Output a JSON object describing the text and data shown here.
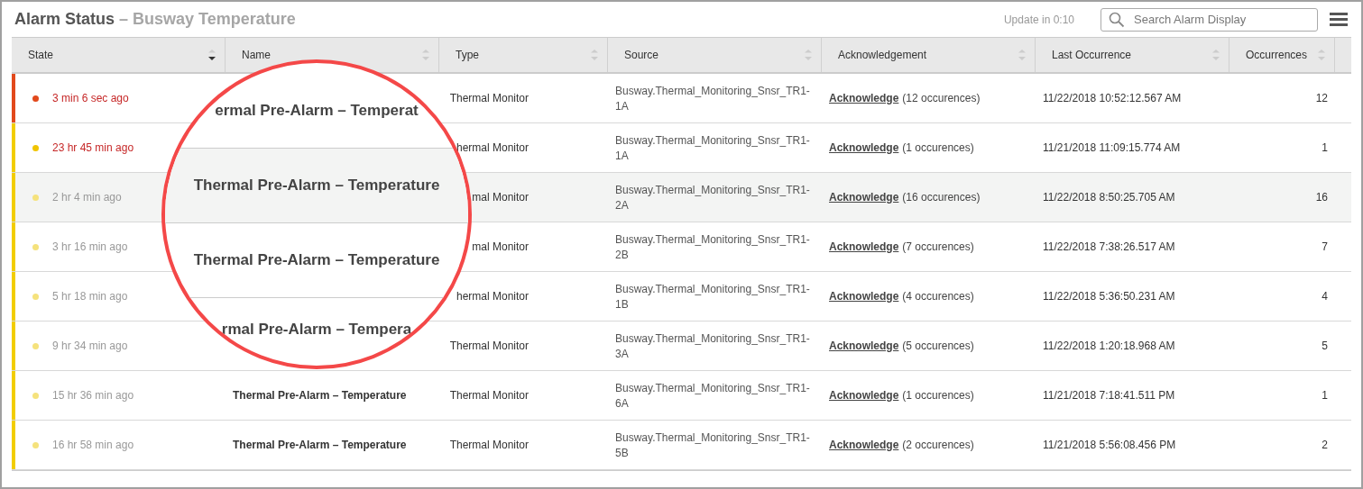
{
  "header": {
    "title": "Alarm Status",
    "subtitle": "– Busway Temperature",
    "update": "Update in 0:10",
    "search": {
      "placeholder": "Search Alarm Display"
    }
  },
  "table": {
    "columns": [
      {
        "label": "State",
        "sorted": true
      },
      {
        "label": "Name",
        "sorted": false
      },
      {
        "label": "Type",
        "sorted": false
      },
      {
        "label": "Source",
        "sorted": false
      },
      {
        "label": "Acknowledgement",
        "sorted": false
      },
      {
        "label": "Last Occurrence",
        "sorted": false
      },
      {
        "label": "Occurrences",
        "sorted": false
      }
    ],
    "rows": [
      {
        "alarm": true,
        "color": "#e2491c",
        "active": true,
        "selected": false,
        "state": "3 min 6 sec ago",
        "type": "Thermal Monitor",
        "source": [
          "Busway.Thermal_Monitoring_Snsr_TR1-",
          "1A"
        ],
        "ack_link": "Acknowledge",
        "ack_count": "(12 occurences)",
        "last": "11/22/2018 10:52:12.567 AM",
        "occurrences": "12"
      },
      {
        "alarm": false,
        "color": "#f0c400",
        "active": true,
        "selected": false,
        "state": "23 hr 45 min ago",
        "type": "hermal Monitor",
        "source": [
          "Busway.Thermal_Monitoring_Snsr_TR1-",
          "1A"
        ],
        "ack_link": "Acknowledge",
        "ack_count": "(1 occurences)",
        "last": "11/21/2018 11:09:15.774 AM",
        "occurrences": "1"
      },
      {
        "alarm": false,
        "color": "#f5e27c",
        "active": false,
        "selected": true,
        "state": "2 hr 4 min ago",
        "type": "mal Monitor",
        "source": [
          "Busway.Thermal_Monitoring_Snsr_TR1-",
          "2A"
        ],
        "ack_link": "Acknowledge",
        "ack_count": "(16 occurences)",
        "last": "11/22/2018 8:50:25.705 AM",
        "occurrences": "16"
      },
      {
        "alarm": false,
        "color": "#f5e27c",
        "active": false,
        "selected": false,
        "state": "3 hr 16 min ago",
        "type": "mal Monitor",
        "source": [
          "Busway.Thermal_Monitoring_Snsr_TR1-",
          "2B"
        ],
        "ack_link": "Acknowledge",
        "ack_count": "(7 occurences)",
        "last": "11/22/2018 7:38:26.517 AM",
        "occurrences": "7"
      },
      {
        "alarm": false,
        "color": "#f5e27c",
        "active": false,
        "selected": false,
        "state": "5 hr 18 min ago",
        "type": "hermal Monitor",
        "source": [
          "Busway.Thermal_Monitoring_Snsr_TR1-",
          "1B"
        ],
        "ack_link": "Acknowledge",
        "ack_count": "(4 occurences)",
        "last": "11/22/2018 5:36:50.231 AM",
        "occurrences": "4"
      },
      {
        "alarm": false,
        "color": "#f5e27c",
        "active": false,
        "selected": false,
        "state": "9 hr 34 min ago",
        "type": "Thermal Monitor",
        "source": [
          "Busway.Thermal_Monitoring_Snsr_TR1-",
          "3A"
        ],
        "ack_link": "Acknowledge",
        "ack_count": "(5 occurences)",
        "last": "11/22/2018 1:20:18.968 AM",
        "occurrences": "5"
      },
      {
        "alarm": false,
        "color": "#f5e27c",
        "active": false,
        "selected": false,
        "state": "15 hr 36 min ago",
        "name": "Thermal Pre-Alarm – Temperature",
        "type": "Thermal Monitor",
        "source": [
          "Busway.Thermal_Monitoring_Snsr_TR1-",
          "6A"
        ],
        "ack_link": "Acknowledge",
        "ack_count": "(1 occurences)",
        "last": "11/21/2018 7:18:41.511 PM",
        "occurrences": "1"
      },
      {
        "alarm": false,
        "color": "#f5e27c",
        "active": false,
        "selected": false,
        "state": "16 hr 58 min ago",
        "name": "Thermal Pre-Alarm – Temperature",
        "type": "Thermal Monitor",
        "source": [
          "Busway.Thermal_Monitoring_Snsr_TR1-",
          "5B"
        ],
        "ack_link": "Acknowledge",
        "ack_count": "(2 occurences)",
        "last": "11/21/2018 5:56:08.456 PM",
        "occurrences": "2"
      }
    ]
  },
  "magnifier": {
    "rows": [
      {
        "text": "ermal Pre-Alarm – Temperat",
        "selected": false
      },
      {
        "text": "Thermal Pre-Alarm – Temperature",
        "selected": true
      },
      {
        "text": "Thermal Pre-Alarm – Temperature",
        "selected": false
      },
      {
        "text": "rmal Pre-Alarm – Tempera",
        "selected": false
      }
    ]
  }
}
